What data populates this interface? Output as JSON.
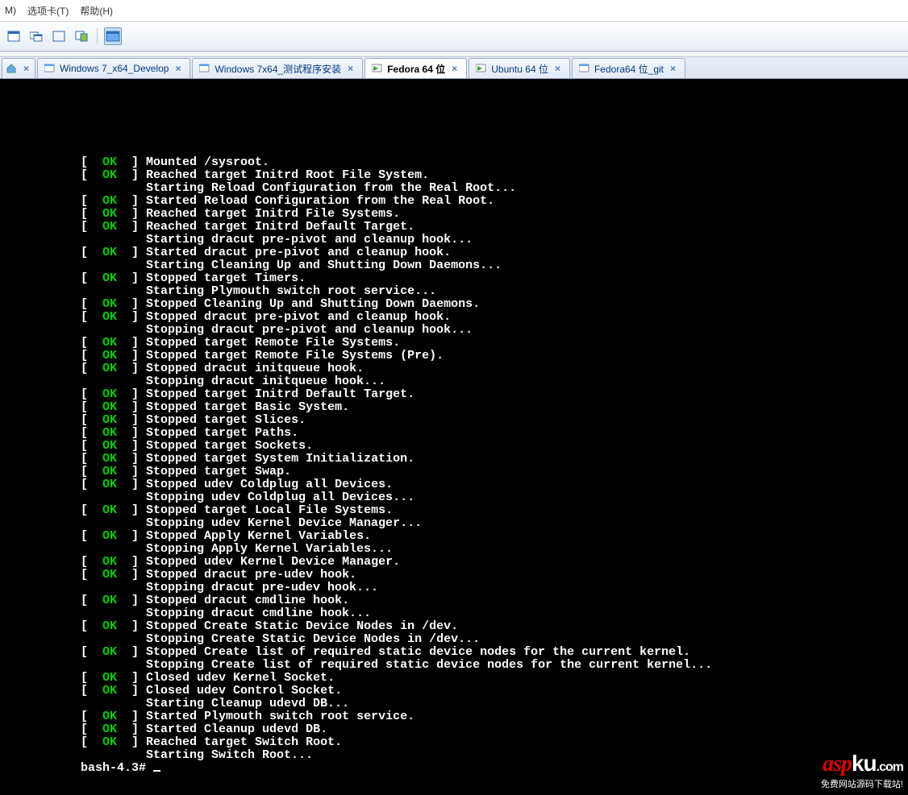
{
  "menu": {
    "m": "M)",
    "tabs": "选项卡(T)",
    "help": "帮助(H)"
  },
  "tabs": {
    "closeGlyph": "×",
    "items": [
      "Windows 7_x64_Develop",
      "Windows 7x64_测试程序安装",
      "Fedora 64 位",
      "Ubuntu 64 位",
      "Fedora64 位_git"
    ]
  },
  "watermark": {
    "brand1": "asp",
    "brand2": "ku",
    "tld": ".com",
    "sub": "免费网站源码下载站!"
  },
  "terminal": {
    "prompt": "bash-4.3# ",
    "lines": [
      {
        "status": "OK",
        "msg": "Mounted /sysroot."
      },
      {
        "status": "OK",
        "msg": "Reached target Initrd Root File System."
      },
      {
        "status": null,
        "msg": "Starting Reload Configuration from the Real Root..."
      },
      {
        "status": "OK",
        "msg": "Started Reload Configuration from the Real Root."
      },
      {
        "status": "OK",
        "msg": "Reached target Initrd File Systems."
      },
      {
        "status": "OK",
        "msg": "Reached target Initrd Default Target."
      },
      {
        "status": null,
        "msg": "Starting dracut pre-pivot and cleanup hook..."
      },
      {
        "status": "OK",
        "msg": "Started dracut pre-pivot and cleanup hook."
      },
      {
        "status": null,
        "msg": "Starting Cleaning Up and Shutting Down Daemons..."
      },
      {
        "status": "OK",
        "msg": "Stopped target Timers."
      },
      {
        "status": null,
        "msg": "Starting Plymouth switch root service..."
      },
      {
        "status": "OK",
        "msg": "Stopped Cleaning Up and Shutting Down Daemons."
      },
      {
        "status": "OK",
        "msg": "Stopped dracut pre-pivot and cleanup hook."
      },
      {
        "status": null,
        "msg": "Stopping dracut pre-pivot and cleanup hook..."
      },
      {
        "status": "OK",
        "msg": "Stopped target Remote File Systems."
      },
      {
        "status": "OK",
        "msg": "Stopped target Remote File Systems (Pre)."
      },
      {
        "status": "OK",
        "msg": "Stopped dracut initqueue hook."
      },
      {
        "status": null,
        "msg": "Stopping dracut initqueue hook..."
      },
      {
        "status": "OK",
        "msg": "Stopped target Initrd Default Target."
      },
      {
        "status": "OK",
        "msg": "Stopped target Basic System."
      },
      {
        "status": "OK",
        "msg": "Stopped target Slices."
      },
      {
        "status": "OK",
        "msg": "Stopped target Paths."
      },
      {
        "status": "OK",
        "msg": "Stopped target Sockets."
      },
      {
        "status": "OK",
        "msg": "Stopped target System Initialization."
      },
      {
        "status": "OK",
        "msg": "Stopped target Swap."
      },
      {
        "status": "OK",
        "msg": "Stopped udev Coldplug all Devices."
      },
      {
        "status": null,
        "msg": "Stopping udev Coldplug all Devices..."
      },
      {
        "status": "OK",
        "msg": "Stopped target Local File Systems."
      },
      {
        "status": null,
        "msg": "Stopping udev Kernel Device Manager..."
      },
      {
        "status": "OK",
        "msg": "Stopped Apply Kernel Variables."
      },
      {
        "status": null,
        "msg": "Stopping Apply Kernel Variables..."
      },
      {
        "status": "OK",
        "msg": "Stopped udev Kernel Device Manager."
      },
      {
        "status": "OK",
        "msg": "Stopped dracut pre-udev hook."
      },
      {
        "status": null,
        "msg": "Stopping dracut pre-udev hook..."
      },
      {
        "status": "OK",
        "msg": "Stopped dracut cmdline hook."
      },
      {
        "status": null,
        "msg": "Stopping dracut cmdline hook..."
      },
      {
        "status": "OK",
        "msg": "Stopped Create Static Device Nodes in /dev."
      },
      {
        "status": null,
        "msg": "Stopping Create Static Device Nodes in /dev..."
      },
      {
        "status": "OK",
        "msg": "Stopped Create list of required static device nodes for the current kernel."
      },
      {
        "status": null,
        "msg": "Stopping Create list of required static device nodes for the current kernel..."
      },
      {
        "status": "OK",
        "msg": "Closed udev Kernel Socket."
      },
      {
        "status": "OK",
        "msg": "Closed udev Control Socket."
      },
      {
        "status": null,
        "msg": "Starting Cleanup udevd DB..."
      },
      {
        "status": "OK",
        "msg": "Started Plymouth switch root service."
      },
      {
        "status": "OK",
        "msg": "Started Cleanup udevd DB."
      },
      {
        "status": "OK",
        "msg": "Reached target Switch Root."
      },
      {
        "status": null,
        "msg": "Starting Switch Root..."
      }
    ]
  }
}
